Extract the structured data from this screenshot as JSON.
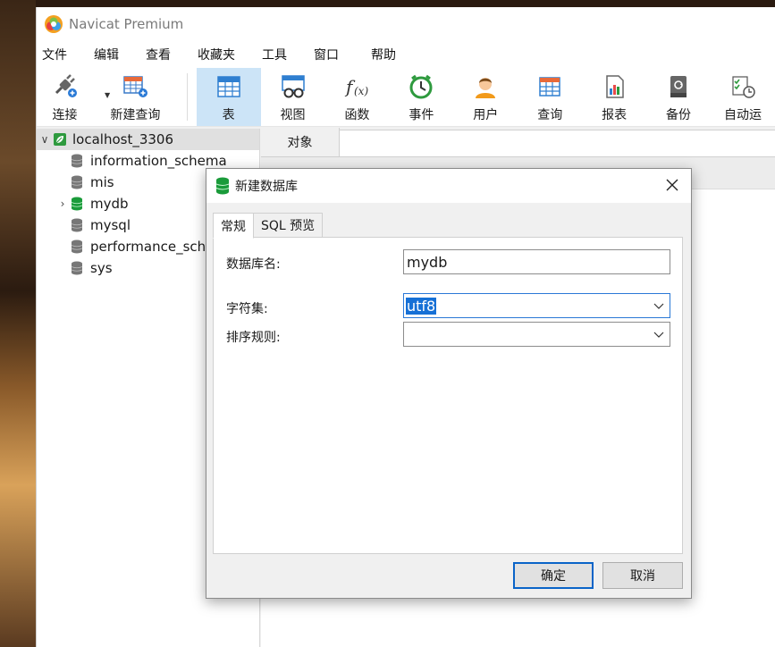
{
  "app": {
    "title": "Navicat Premium"
  },
  "menu": [
    "文件",
    "编辑",
    "查看",
    "收藏夹",
    "工具",
    "窗口",
    "帮助"
  ],
  "toolbar": {
    "connect": "连接",
    "new_query": "新建查询",
    "items": [
      {
        "label": "表",
        "icon": "table-icon",
        "active": true
      },
      {
        "label": "视图",
        "icon": "view-icon"
      },
      {
        "label": "函数",
        "icon": "function-icon"
      },
      {
        "label": "事件",
        "icon": "event-clock-icon"
      },
      {
        "label": "用户",
        "icon": "user-icon"
      },
      {
        "label": "查询",
        "icon": "query-icon"
      },
      {
        "label": "报表",
        "icon": "report-icon"
      },
      {
        "label": "备份",
        "icon": "backup-icon"
      },
      {
        "label": "自动运",
        "icon": "automation-icon"
      }
    ]
  },
  "tree": {
    "connection": "localhost_3306",
    "databases": [
      "information_schema",
      "mis",
      "mydb",
      "mysql",
      "performance_schema",
      "sys"
    ]
  },
  "object_panel": {
    "tab": "对象"
  },
  "dialog": {
    "title": "新建数据库",
    "tabs": [
      "常规",
      "SQL 预览"
    ],
    "fields": {
      "db_name_label": "数据库名:",
      "db_name_value": "mydb",
      "charset_label": "字符集:",
      "charset_value": "utf8",
      "collation_label": "排序规则:",
      "collation_value": ""
    },
    "ok": "确定",
    "cancel": "取消"
  },
  "colors": {
    "active_tool": "#cce4f7",
    "selection": "#1670d6",
    "db_active": "#1a9b3a"
  }
}
